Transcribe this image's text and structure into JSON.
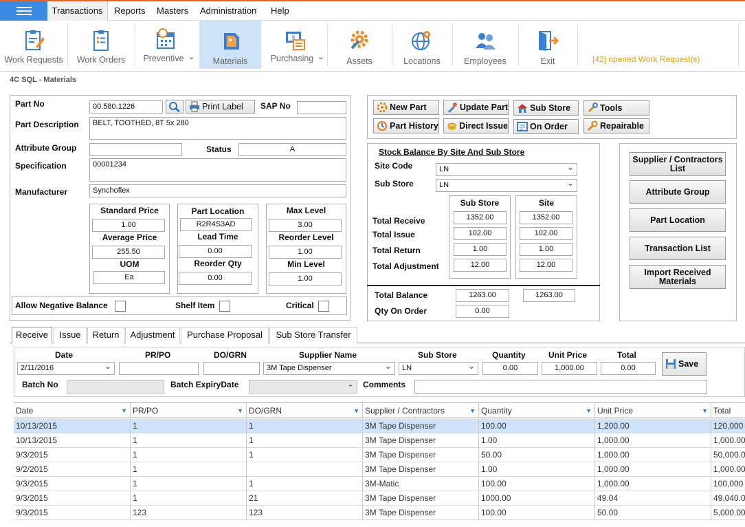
{
  "menu": {
    "items": [
      "Transactions",
      "Reports",
      "Masters",
      "Administration",
      "Help"
    ]
  },
  "toolbar": {
    "buttons": [
      {
        "label": "Work Requests"
      },
      {
        "label": "Work Orders"
      },
      {
        "label": "Preventive"
      },
      {
        "label": "Materials"
      },
      {
        "label": "Purchasing"
      },
      {
        "label": "Assets"
      },
      {
        "label": "Locations"
      },
      {
        "label": "Employees"
      },
      {
        "label": "Exit"
      }
    ],
    "work_request_notice": "[42] opened Work Request(s)"
  },
  "page_title": "4C SQL - Materials",
  "part": {
    "part_no_label": "Part No",
    "part_no": "00.580.1226",
    "print_label": "Print Label",
    "sap_no_label": "SAP No",
    "sap_no": "",
    "description_label": "Part Description",
    "description": "BELT, TOOTHED, 8T 5x 280",
    "attribute_group_label": "Attribute Group",
    "attribute_group": "",
    "status_label": "Status",
    "status": "A",
    "specification_label": "Specification",
    "specification": "00001234",
    "manufacturer_label": "Manufacturer",
    "manufacturer": "Synchoflex"
  },
  "pricing": {
    "standard_price_label": "Standard Price",
    "standard_price": "1.00",
    "average_price_label": "Average Price",
    "average_price": "255.50",
    "uom_label": "UOM",
    "uom": "Ea",
    "part_location_label": "Part Location",
    "part_location": "R2R4S3AD",
    "lead_time_label": "Lead Time",
    "lead_time": "0.00",
    "reorder_qty_label": "Reorder Qty",
    "reorder_qty": "0.00",
    "max_level_label": "Max Level",
    "max_level": "3.00",
    "reorder_level_label": "Reorder Level",
    "reorder_level": "1.00",
    "min_level_label": "Min Level",
    "min_level": "1.00"
  },
  "flags": {
    "allow_negative_label": "Allow Negative Balance",
    "shelf_item_label": "Shelf Item",
    "critical_label": "Critical"
  },
  "actions": {
    "new_part": "New Part",
    "update_part": "Update Part",
    "sub_store": "Sub Store",
    "tools": "Tools",
    "part_history": "Part History",
    "direct_issue": "Direct Issue",
    "on_order": "On Order",
    "repairable": "Repairable"
  },
  "stock": {
    "title": "Stock Balance By Site And Sub Store",
    "site_code_label": "Site Code",
    "site_code": "LN",
    "sub_store_label": "Sub Store",
    "sub_store": "LN",
    "col_sub_store": "Sub Store",
    "col_site": "Site",
    "rows": [
      {
        "label": "Total Receive",
        "sub": "1352.00",
        "site": "1352.00"
      },
      {
        "label": "Total Issue",
        "sub": "102.00",
        "site": "102.00"
      },
      {
        "label": "Total Return",
        "sub": "1.00",
        "site": "1.00"
      },
      {
        "label": "Total Adjustment",
        "sub": "12.00",
        "site": "12.00"
      }
    ],
    "total_balance_label": "Total Balance",
    "total_balance_sub": "1263.00",
    "total_balance_site": "1263.00",
    "qty_on_order_label": "Qty On Order",
    "qty_on_order": "0.00"
  },
  "side_buttons": [
    "Supplier / Contractors List",
    "Attribute Group",
    "Part Location",
    "Transaction List",
    "Import Received Materials"
  ],
  "tabs": [
    "Receive",
    "Issue",
    "Return",
    "Adjustment",
    "Purchase Proposal",
    "Sub Store Transfer"
  ],
  "receive_form": {
    "date_label": "Date",
    "date": "2/11/2016",
    "prpo_label": "PR/PO",
    "prpo": "",
    "dogrn_label": "DO/GRN",
    "dogrn": "",
    "supplier_label": "Supplier Name",
    "supplier": "3M Tape Dispenser",
    "sub_store_label": "Sub Store",
    "sub_store": "LN",
    "quantity_label": "Quantity",
    "quantity": "0.00",
    "unit_price_label": "Unit Price",
    "unit_price": "1,000.00",
    "total_label": "Total",
    "total": "0.00",
    "save_label": "Save",
    "batch_no_label": "Batch No",
    "batch_expiry_label": "Batch ExpiryDate",
    "comments_label": "Comments"
  },
  "grid": {
    "columns": [
      "Date",
      "PR/PO",
      "DO/GRN",
      "Supplier / Contractors",
      "Quantity",
      "Unit Price",
      "Total"
    ],
    "rows": [
      [
        "10/13/2015",
        "1",
        "1",
        "3M Tape Dispenser",
        "100.00",
        "1,200.00",
        "120,000"
      ],
      [
        "10/13/2015",
        "1",
        "1",
        "3M Tape Dispenser",
        "1.00",
        "1,000.00",
        "1,000.00"
      ],
      [
        "9/3/2015",
        "1",
        "1",
        "3M Tape Dispenser",
        "50.00",
        "1,000.00",
        "50,000.0"
      ],
      [
        "9/2/2015",
        "1",
        "",
        "3M Tape Dispenser",
        "1.00",
        "1,000.00",
        "1,000.00"
      ],
      [
        "9/3/2015",
        "1",
        "1",
        "3M-Matic",
        "100.00",
        "1,000.00",
        "100,000"
      ],
      [
        "9/3/2015",
        "1",
        "21",
        "3M Tape Dispenser",
        "1000.00",
        "49.04",
        "49,040.0"
      ],
      [
        "9/3/2015",
        "123",
        "123",
        "3M Tape Dispenser",
        "100.00",
        "50.00",
        "5,000.00"
      ]
    ]
  }
}
